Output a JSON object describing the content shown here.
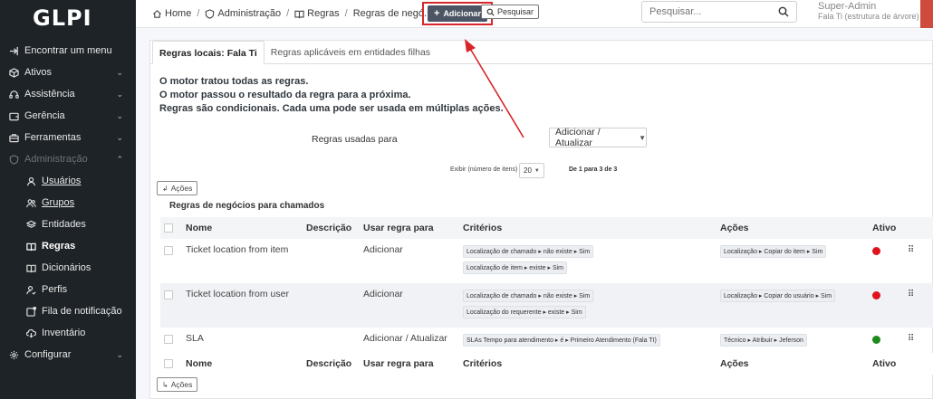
{
  "app": {
    "logo": "GLPI"
  },
  "sidebar": {
    "items": [
      {
        "label": "Encontrar um menu",
        "icon": "arrow-right-icon",
        "has_chevron": false
      },
      {
        "label": "Ativos",
        "icon": "box-icon",
        "has_chevron": true
      },
      {
        "label": "Assistência",
        "icon": "headset-icon",
        "has_chevron": true
      },
      {
        "label": "Gerência",
        "icon": "wallet-icon",
        "has_chevron": true
      },
      {
        "label": "Ferramentas",
        "icon": "briefcase-icon",
        "has_chevron": true
      },
      {
        "label": "Administração",
        "icon": "shield-icon",
        "has_chevron": true
      }
    ],
    "subitems": [
      {
        "label": "Usuários",
        "icon": "user-icon"
      },
      {
        "label": "Grupos",
        "icon": "users-icon"
      },
      {
        "label": "Entidades",
        "icon": "stack-icon"
      },
      {
        "label": "Regras",
        "icon": "book-icon"
      },
      {
        "label": "Dicionários",
        "icon": "book-icon"
      },
      {
        "label": "Perfis",
        "icon": "user-check-icon"
      },
      {
        "label": "Fila de notificação",
        "icon": "notification-icon"
      },
      {
        "label": "Inventário",
        "icon": "cloud-download-icon"
      }
    ],
    "footer_item": {
      "label": "Configurar",
      "icon": "gear-icon"
    }
  },
  "header": {
    "breadcrumb": [
      "Home",
      "Administração",
      "Regras",
      "Regras de negó..."
    ],
    "add_label": "Adicionar",
    "search_button_label": "Pesquisar",
    "search_placeholder": "Pesquisar...",
    "user_name": "Super-Admin",
    "user_entity": "Fala Ti (estrutura de árvore)"
  },
  "tabs": [
    "Regras locais: Fala Ti",
    "Regras aplicáveis em entidades filhas"
  ],
  "info_lines": [
    "O motor tratou todas as regras.",
    "O motor passou o resultado da regra para a próxima.",
    "Regras são condicionais. Cada uma pode ser usada em múltiplas ações."
  ],
  "filter": {
    "label": "Regras usadas para",
    "selected": "Adicionar / Atualizar"
  },
  "pager": {
    "label": "Exibir (número de itens)",
    "per_page": "20",
    "info": "De 1 para 3 de 3"
  },
  "actions_label": "Ações",
  "table": {
    "title": "Regras de negócios para chamados",
    "headers": [
      "Nome",
      "Descrição",
      "Usar regra para",
      "Critérios",
      "Ações",
      "Ativo"
    ],
    "rows": [
      {
        "name": "Ticket location from item",
        "description": "",
        "use_for": "Adicionar",
        "criteria": [
          "Localização de chamado ▸ não existe ▸ Sim",
          "Localização de item ▸ existe ▸ Sim"
        ],
        "actions": [
          "Localização ▸ Copiar do item ▸ Sim"
        ],
        "active_color": "#e0121b"
      },
      {
        "name": "Ticket location from user",
        "description": "",
        "use_for": "Adicionar",
        "criteria": [
          "Localização de chamado ▸ não existe ▸ Sim",
          "Localização do requerente ▸ existe ▸ Sim"
        ],
        "actions": [
          "Localização ▸ Copiar do usuário ▸ Sim"
        ],
        "active_color": "#e0121b"
      },
      {
        "name": "SLA",
        "description": "",
        "use_for": "Adicionar / Atualizar",
        "criteria": [
          "SLAs Tempo para atendimento ▸ é ▸ Primeiro Atendimento (Fala TI)"
        ],
        "actions": [
          "Técnico ▸ Atribuir ▸ Jeferson"
        ],
        "active_color": "#1c8a1c"
      }
    ]
  },
  "colors": {
    "sidebar_bg": "#1e2327",
    "highlight_box": "#d7262a",
    "add_button": "#4c5563"
  }
}
